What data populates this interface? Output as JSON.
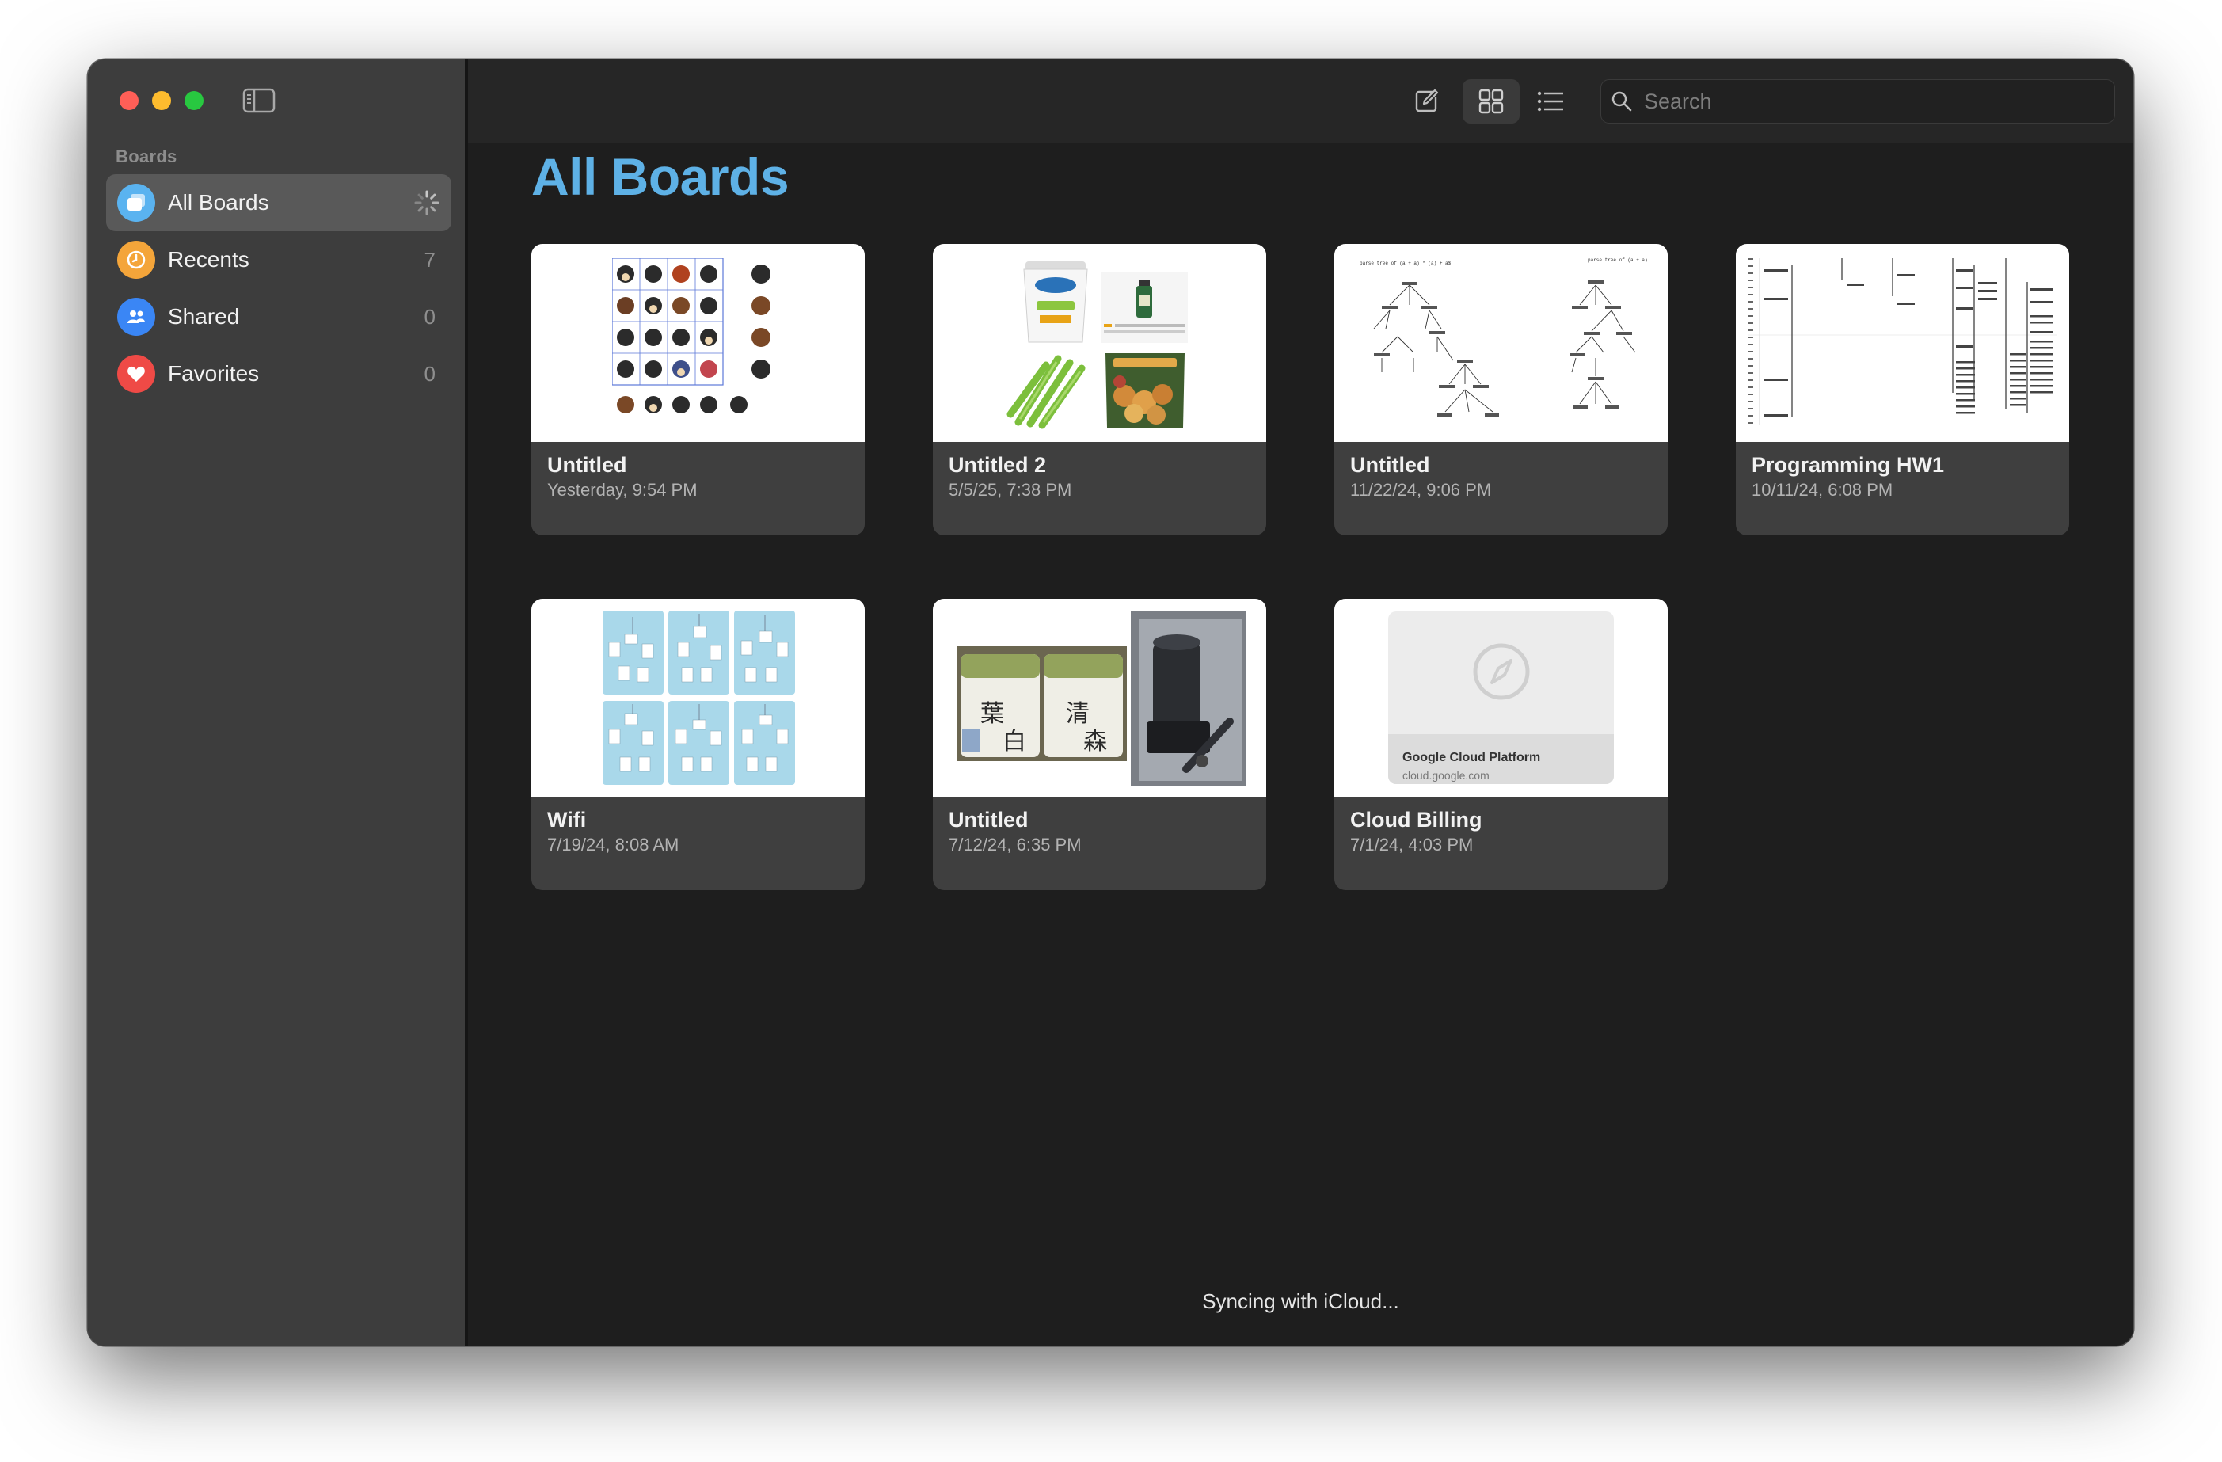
{
  "sidebar": {
    "header": "Boards",
    "items": [
      {
        "label": "All Boards",
        "count": "",
        "color": "#5ab3f0",
        "icon": "boards-icon",
        "selected": true
      },
      {
        "label": "Recents",
        "count": "7",
        "color": "#f4a53a",
        "icon": "clock-icon"
      },
      {
        "label": "Shared",
        "count": "0",
        "color": "#3a86f5",
        "icon": "people-icon"
      },
      {
        "label": "Favorites",
        "count": "0",
        "color": "#ef4a46",
        "icon": "heart-icon"
      }
    ]
  },
  "toolbar": {
    "new_board_icon": "compose-icon",
    "grid_view_icon": "grid-icon",
    "list_view_icon": "list-icon",
    "search_placeholder": "Search"
  },
  "main": {
    "title": "All Boards",
    "title_color": "#5eb1e6",
    "boards": [
      {
        "title": "Untitled",
        "date": "Yesterday, 9:54 PM"
      },
      {
        "title": "Untitled 2",
        "date": "5/5/25, 7:38 PM"
      },
      {
        "title": "Untitled",
        "date": "11/22/24, 9:06 PM"
      },
      {
        "title": "Programming HW1",
        "date": "10/11/24, 6:08 PM"
      },
      {
        "title": "Wifi",
        "date": "7/19/24, 8:08 AM"
      },
      {
        "title": "Untitled",
        "date": "7/12/24, 6:35 PM"
      },
      {
        "title": "Cloud Billing",
        "date": "7/1/24, 4:03 PM",
        "link_title": "Google Cloud Platform",
        "link_url": "cloud.google.com"
      }
    ],
    "status": "Syncing with iCloud..."
  }
}
